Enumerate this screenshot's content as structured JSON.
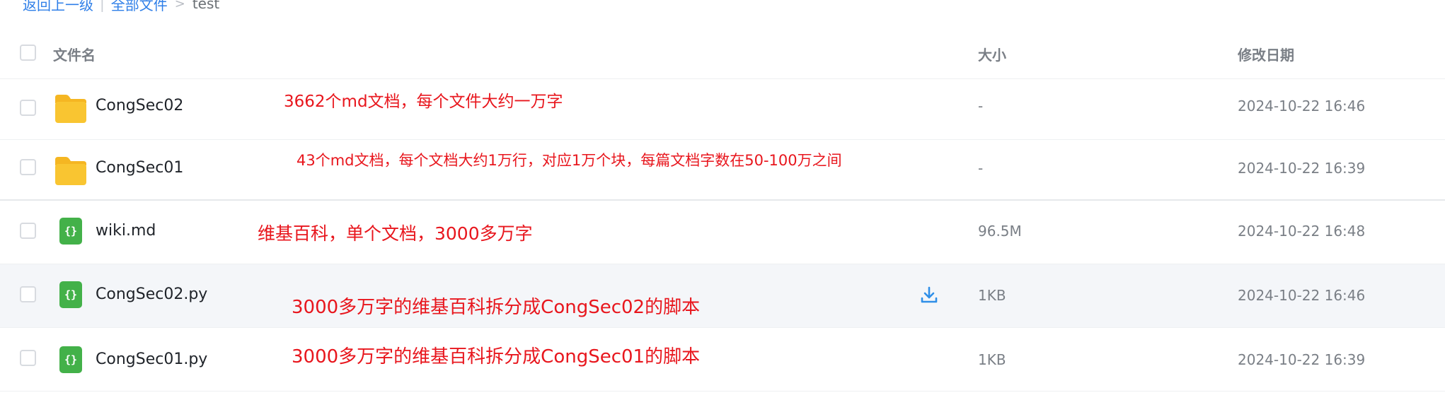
{
  "breadcrumb": {
    "back": "返回上一级",
    "all_files": "全部文件",
    "current": "test"
  },
  "table": {
    "headers": {
      "name": "文件名",
      "size": "大小",
      "modified": "修改日期"
    },
    "rows": [
      {
        "name": "CongSec02",
        "type": "folder",
        "size": "-",
        "modified": "2024-10-22 16:46",
        "annotation": "3662个md文档，每个文件大约一万字"
      },
      {
        "name": "CongSec01",
        "type": "folder",
        "size": "-",
        "modified": "2024-10-22 16:39",
        "annotation": "43个md文档，每个文档大约1万行，对应1万个块，每篇文档字数在50-100万之间"
      },
      {
        "name": "wiki.md",
        "type": "code-file",
        "size": "96.5M",
        "modified": "2024-10-22 16:48",
        "annotation": "维基百科，单个文档，3000多万字"
      },
      {
        "name": "CongSec02.py",
        "type": "code-file",
        "size": "1KB",
        "modified": "2024-10-22 16:46",
        "annotation": "3000多万字的维基百科拆分成CongSec02的脚本"
      },
      {
        "name": "CongSec01.py",
        "type": "code-file",
        "size": "1KB",
        "modified": "2024-10-22 16:39",
        "annotation": "3000多万字的维基百科拆分成CongSec01的脚本"
      }
    ]
  },
  "icons": {
    "folder": "folder-icon",
    "code_file": "code-file-icon",
    "code_glyph": "{}",
    "download": "download-icon"
  },
  "colors": {
    "link": "#2f7fe8",
    "annotation": "#e8161d",
    "folder": "#f9c531",
    "code_file": "#43b149",
    "download": "#2f8fe8",
    "row_highlight": "#f4f6f9"
  }
}
